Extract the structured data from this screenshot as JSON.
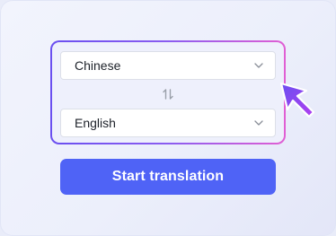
{
  "translator": {
    "source_language": {
      "selected": "Chinese",
      "icon": "chevron-down-icon"
    },
    "swap": {
      "icon": "swap-vertical-icon"
    },
    "target_language": {
      "selected": "English",
      "icon": "chevron-down-icon"
    },
    "start_button_label": "Start translation"
  },
  "colors": {
    "button_bg": "#4f63f6",
    "frame_gradient_start": "#6a4ff0",
    "frame_gradient_end": "#e15fd4",
    "cursor_color": "#8e3ff0"
  }
}
